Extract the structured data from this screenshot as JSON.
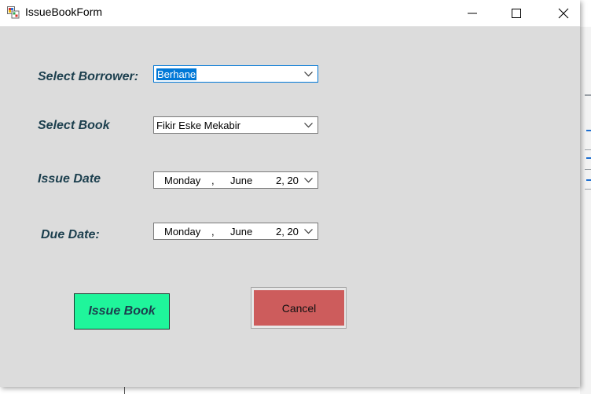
{
  "window": {
    "title": "IssueBookForm"
  },
  "form": {
    "select_borrower_label": "Select Borrower:",
    "select_book_label": "Select Book",
    "issue_date_label": "Issue Date",
    "due_date_label": "Due Date:",
    "borrower_value": "Berhane",
    "book_value": "Fikir Eske Mekabir",
    "issue_date": {
      "weekday": "Monday",
      "sep": ",",
      "month": "June",
      "day_year": "2, 20"
    },
    "due_date": {
      "weekday": "Monday",
      "sep": ",",
      "month": "June",
      "day_year": "2, 20"
    },
    "issue_button_label": "Issue Book",
    "cancel_button_label": "Cancel"
  },
  "icons": {
    "app": "form-icon",
    "minimize": "minimize-icon",
    "maximize": "maximize-icon",
    "close": "close-icon",
    "dropdown": "chevron-down-icon"
  },
  "colors": {
    "window_bg": "#dcdcdc",
    "label_text": "#1c3f4e",
    "issue_button_bg": "#1ff59b",
    "cancel_button_bg": "#cd5c5c",
    "focus_accent": "#0078d7"
  }
}
